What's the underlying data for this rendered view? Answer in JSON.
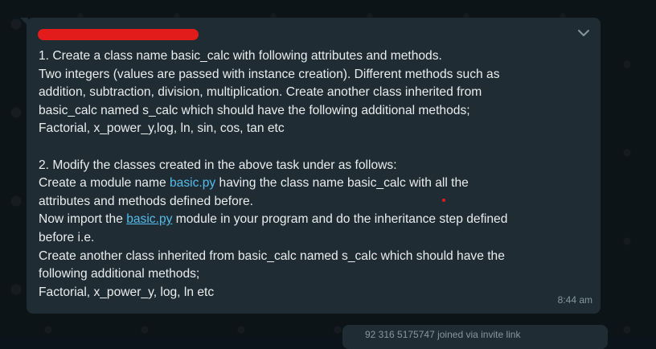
{
  "message": {
    "sender": "",
    "timestamp": "8:44 am",
    "p1_line1": "1. Create a class name basic_calc with following attributes and methods.",
    "p1_line2": "Two integers (values are passed with instance creation). Different methods such as",
    "p1_line3": "addition, subtraction, division, multiplication. Create another class inherited from",
    "p1_line4": "basic_calc named s_calc which should have the following additional methods;",
    "p1_line5": "Factorial, x_power_y,log, ln, sin, cos, tan etc",
    "p2_line1": "2. Modify the classes created in the above task under as follows:",
    "p2_line2_before": "Create a module name ",
    "p2_link1": "basic.py",
    "p2_line2_after": " having the class name basic_calc with all the",
    "p2_line3": "attributes and methods defined before.",
    "p2_line4_before": "Now import the ",
    "p2_link2": "basic.py",
    "p2_line4_after": " module in your program and do the inheritance step defined",
    "p2_line5": "before i.e.",
    "p2_line6": "Create another class inherited from basic_calc named s_calc which should have the",
    "p2_line7": "following additional methods;",
    "p2_line8": "Factorial, x_power_y, log, ln etc"
  },
  "next_message": {
    "preview": "92 316 5175747 joined via invite link"
  },
  "colors": {
    "bubble": "#202c33",
    "text": "#e9edef",
    "link": "#53bdeb",
    "meta": "#8696a0",
    "redaction": "#e21b1b"
  },
  "icons": {
    "menu": "chevron-down-icon"
  }
}
